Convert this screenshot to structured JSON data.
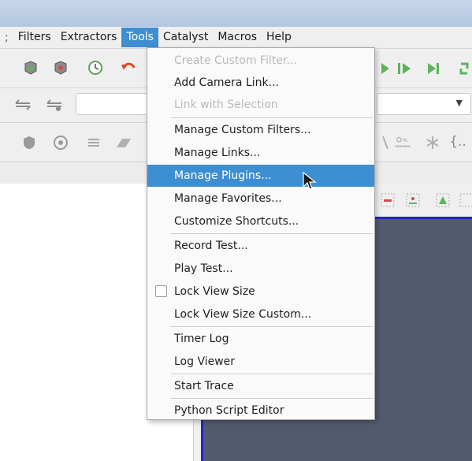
{
  "menubar": {
    "sep_glyph": ";",
    "items": [
      "Filters",
      "Extractors",
      "Tools",
      "Catalyst",
      "Macros",
      "Help"
    ],
    "active_index": 2
  },
  "tools_menu": {
    "items": [
      {
        "label": "Create Custom Filter...",
        "disabled": true
      },
      {
        "label": "Add Camera Link..."
      },
      {
        "label": "Link with Selection",
        "disabled": true
      },
      {
        "label": "Manage Custom Filters..."
      },
      {
        "label": "Manage Links..."
      },
      {
        "label": "Manage Plugins...",
        "highlighted": true
      },
      {
        "label": "Manage Favorites..."
      },
      {
        "label": "Customize Shortcuts..."
      },
      {
        "label": "Record Test..."
      },
      {
        "label": "Play Test..."
      },
      {
        "label": "Lock View Size",
        "checkbox": true,
        "checked": false
      },
      {
        "label": "Lock View Size Custom..."
      },
      {
        "label": "Timer Log"
      },
      {
        "label": "Log Viewer"
      },
      {
        "label": "Start Trace"
      },
      {
        "label": "Python Script Editor"
      }
    ]
  },
  "toolbar3": {
    "extra_text": "{.."
  },
  "colors": {
    "highlight": "#3d8fd1",
    "view_background": "#525a6f",
    "view_border": "#2424c8"
  }
}
